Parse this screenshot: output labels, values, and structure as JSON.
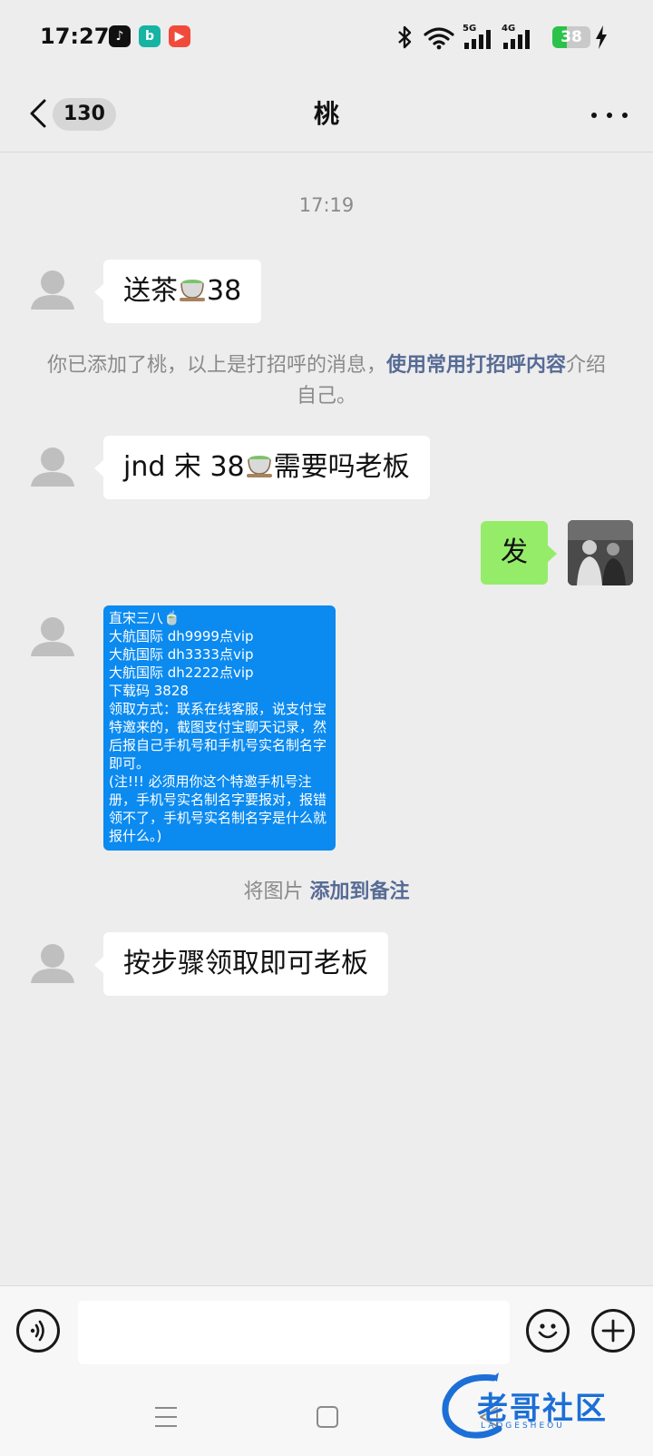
{
  "status_bar": {
    "time": "17:27",
    "app_icons": [
      "tiktok-icon",
      "bilibili-icon",
      "video-player-icon"
    ],
    "network_5g": "5G",
    "network_4g": "4G",
    "battery": "38",
    "battery_level": 0.38,
    "charging": true
  },
  "nav": {
    "back_label": "<",
    "unread_count": "130",
    "title": "桃",
    "more_icon": "more-icon"
  },
  "chat": {
    "timestamp": "17:19",
    "messages": [
      {
        "id": "m1",
        "direction": "in",
        "text_prefix": "送茶",
        "emoji": "tea-cup-emoji",
        "text_suffix": "38"
      },
      {
        "id": "m2",
        "direction": "in",
        "text_prefix": "jnd 宋 38",
        "emoji": "tea-cup-emoji",
        "text_suffix": "需要吗老板"
      },
      {
        "id": "m3",
        "direction": "out",
        "text": "发"
      },
      {
        "id": "m4",
        "direction": "in",
        "type": "image"
      },
      {
        "id": "m5",
        "direction": "in",
        "text": "按步骤领取即可老板"
      }
    ],
    "system_note_1": {
      "plain": "你已添加了桃，以上是打招呼的消息，",
      "link": "使用常用打招呼内容",
      "plain_after": "介绍自己。"
    },
    "image_message": {
      "lines": [
        "直宋三八🍵",
        "大航国际 dh9999点vip",
        "大航国际 dh3333点vip",
        "大航国际 dh2222点vip",
        "下载码 3828",
        "领取方式：联系在线客服，说支付宝特邀来的，截图支付宝聊天记录，然后报自己手机号和手机号实名制名字即可。",
        "(注!!! 必须用你这个特邀手机号注册，手机号实名制名字要报对，报错领不了，手机号实名制名字是什么就报什么。)"
      ]
    },
    "system_note_2": {
      "plain": "将图片 ",
      "link": "添加到备注"
    }
  },
  "input_bar": {
    "voice_icon": "voice-icon",
    "input_value": "",
    "emoji_icon": "emoji-icon",
    "plus_icon": "plus-icon"
  },
  "system_nav": {
    "menu_icon": "menu-icon",
    "home_icon": "home-icon",
    "back_icon": "back-triangle-icon"
  },
  "watermark": {
    "text": "老哥社区",
    "sub": "LAOGESHEOU"
  },
  "colors": {
    "background": "#ededed",
    "bubble_in": "#ffffff",
    "bubble_out": "#95ec69",
    "link": "#576b95",
    "image_bg": "#0b8af0"
  }
}
